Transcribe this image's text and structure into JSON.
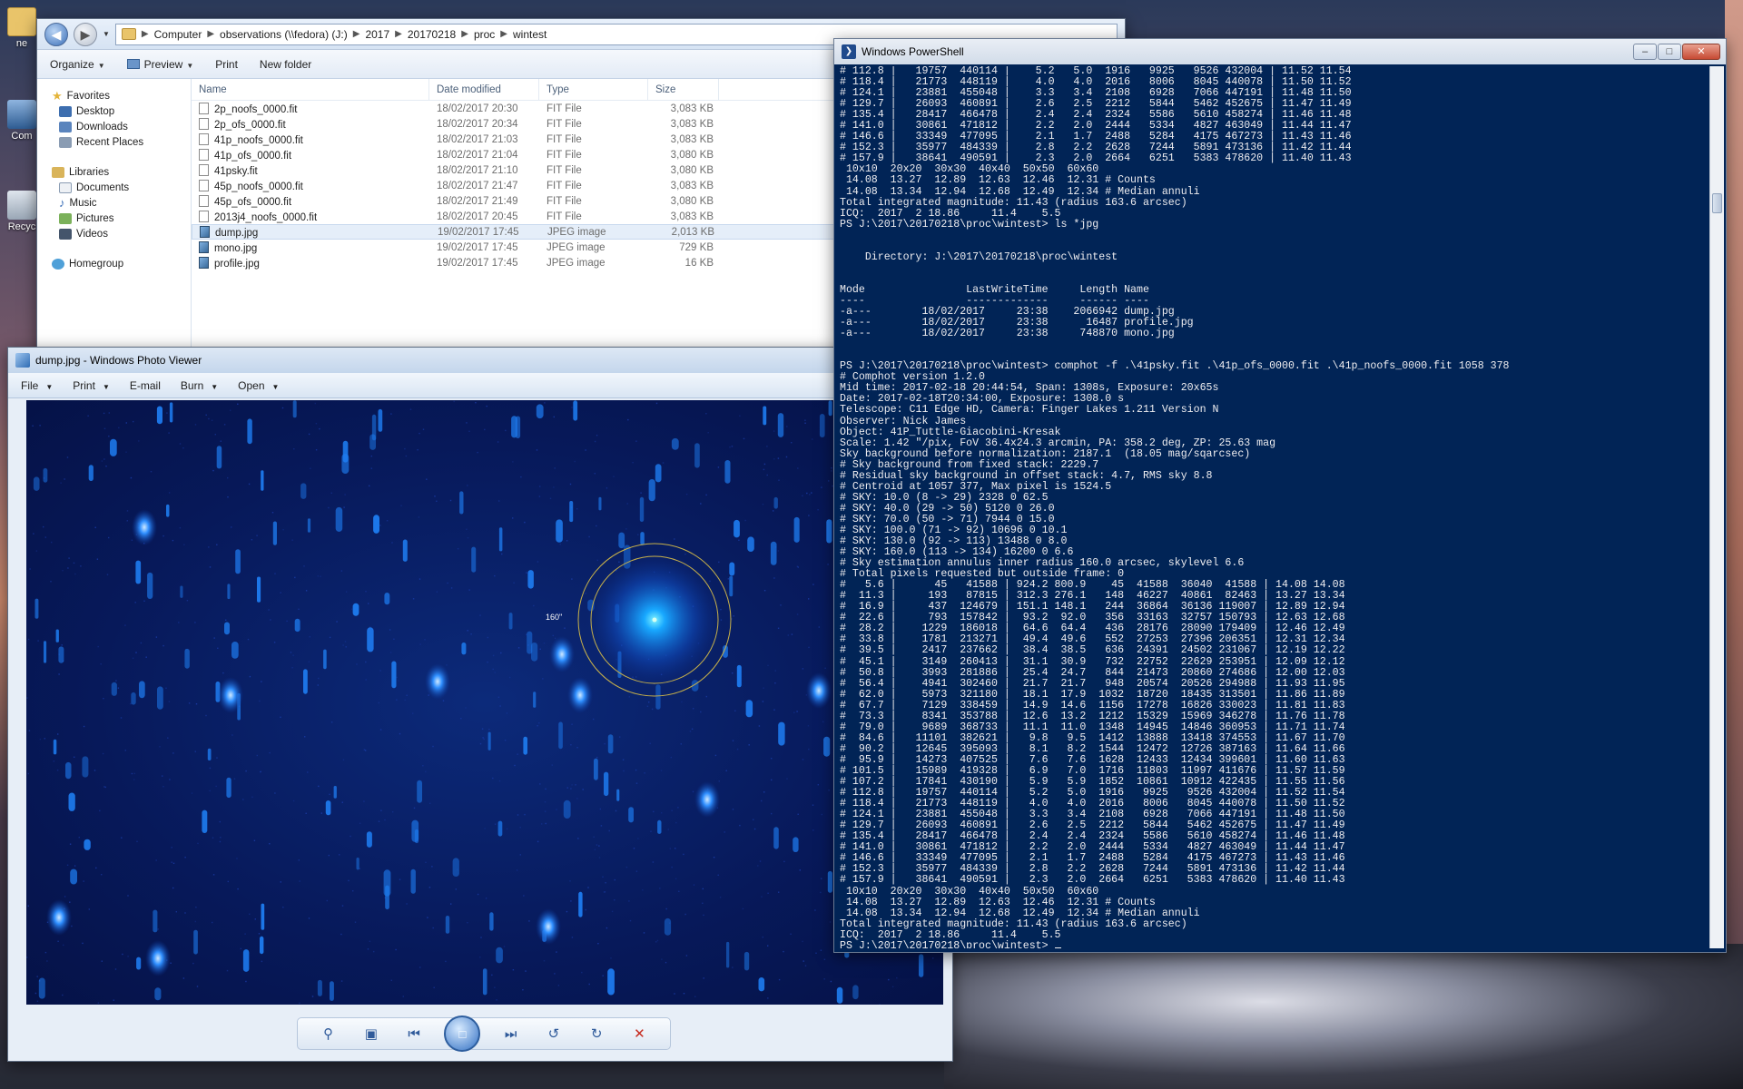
{
  "desktop": {
    "icons": [
      {
        "label": "ne"
      },
      {
        "label": "Com"
      },
      {
        "label": "Recyc"
      }
    ]
  },
  "explorer": {
    "breadcrumbs": [
      "Computer",
      "observations (\\\\fedora) (J:)",
      "2017",
      "20170218",
      "proc",
      "wintest"
    ],
    "toolbar": {
      "organize": "Organize",
      "preview": "Preview",
      "print": "Print",
      "new_folder": "New folder"
    },
    "nav": {
      "favorites": "Favorites",
      "desktop": "Desktop",
      "downloads": "Downloads",
      "recent": "Recent Places",
      "libraries": "Libraries",
      "documents": "Documents",
      "music": "Music",
      "pictures": "Pictures",
      "videos": "Videos",
      "homegroup": "Homegroup"
    },
    "columns": {
      "name": "Name",
      "date": "Date modified",
      "type": "Type",
      "size": "Size"
    },
    "files": [
      {
        "name": "2p_noofs_0000.fit",
        "date": "18/02/2017 20:30",
        "type": "FIT File",
        "size": "3,083 KB",
        "kind": "fit"
      },
      {
        "name": "2p_ofs_0000.fit",
        "date": "18/02/2017 20:34",
        "type": "FIT File",
        "size": "3,083 KB",
        "kind": "fit"
      },
      {
        "name": "41p_noofs_0000.fit",
        "date": "18/02/2017 21:03",
        "type": "FIT File",
        "size": "3,083 KB",
        "kind": "fit"
      },
      {
        "name": "41p_ofs_0000.fit",
        "date": "18/02/2017 21:04",
        "type": "FIT File",
        "size": "3,080 KB",
        "kind": "fit"
      },
      {
        "name": "41psky.fit",
        "date": "18/02/2017 21:10",
        "type": "FIT File",
        "size": "3,080 KB",
        "kind": "fit"
      },
      {
        "name": "45p_noofs_0000.fit",
        "date": "18/02/2017 21:47",
        "type": "FIT File",
        "size": "3,083 KB",
        "kind": "fit"
      },
      {
        "name": "45p_ofs_0000.fit",
        "date": "18/02/2017 21:49",
        "type": "FIT File",
        "size": "3,080 KB",
        "kind": "fit"
      },
      {
        "name": "2013j4_noofs_0000.fit",
        "date": "18/02/2017 20:45",
        "type": "FIT File",
        "size": "3,083 KB",
        "kind": "fit"
      },
      {
        "name": "dump.jpg",
        "date": "19/02/2017 17:45",
        "type": "JPEG image",
        "size": "2,013 KB",
        "kind": "jpg"
      },
      {
        "name": "mono.jpg",
        "date": "19/02/2017 17:45",
        "type": "JPEG image",
        "size": "729 KB",
        "kind": "jpg"
      },
      {
        "name": "profile.jpg",
        "date": "19/02/2017 17:45",
        "type": "JPEG image",
        "size": "16 KB",
        "kind": "jpg"
      }
    ],
    "selected_index": 8
  },
  "viewer": {
    "title": "dump.jpg - Windows Photo Viewer",
    "menu": {
      "file": "File",
      "print": "Print",
      "email": "E-mail",
      "burn": "Burn",
      "open": "Open"
    },
    "aperture_label": "160\""
  },
  "powershell": {
    "title": "Windows PowerShell",
    "lines": [
      "# 112.8 |   19757  440114 |    5.2   5.0  1916   9925   9526 432004 | 11.52 11.54",
      "# 118.4 |   21773  448119 |    4.0   4.0  2016   8006   8045 440078 | 11.50 11.52",
      "# 124.1 |   23881  455048 |    3.3   3.4  2108   6928   7066 447191 | 11.48 11.50",
      "# 129.7 |   26093  460891 |    2.6   2.5  2212   5844   5462 452675 | 11.47 11.49",
      "# 135.4 |   28417  466478 |    2.4   2.4  2324   5586   5610 458274 | 11.46 11.48",
      "# 141.0 |   30861  471812 |    2.2   2.0  2444   5334   4827 463049 | 11.44 11.47",
      "# 146.6 |   33349  477095 |    2.1   1.7  2488   5284   4175 467273 | 11.43 11.46",
      "# 152.3 |   35977  484339 |    2.8   2.2  2628   7244   5891 473136 | 11.42 11.44",
      "# 157.9 |   38641  490591 |    2.3   2.0  2664   6251   5383 478620 | 11.40 11.43",
      " 10x10  20x20  30x30  40x40  50x50  60x60",
      " 14.08  13.27  12.89  12.63  12.46  12.31 # Counts",
      " 14.08  13.34  12.94  12.68  12.49  12.34 # Median annuli",
      "Total integrated magnitude: 11.43 (radius 163.6 arcsec)",
      "ICQ:  2017  2 18.86     11.4    5.5",
      "PS J:\\2017\\20170218\\proc\\wintest> ls *jpg",
      "",
      "",
      "    Directory: J:\\2017\\20170218\\proc\\wintest",
      "",
      "",
      "Mode                LastWriteTime     Length Name",
      "----                -------------     ------ ----",
      "-a---        18/02/2017     23:38    2066942 dump.jpg",
      "-a---        18/02/2017     23:38      16487 profile.jpg",
      "-a---        18/02/2017     23:38     748870 mono.jpg",
      "",
      "",
      "PS J:\\2017\\20170218\\proc\\wintest> comphot -f .\\41psky.fit .\\41p_ofs_0000.fit .\\41p_noofs_0000.fit 1058 378",
      "# Comphot version 1.2.0",
      "Mid time: 2017-02-18 20:44:54, Span: 1308s, Exposure: 20x65s",
      "Date: 2017-02-18T20:34:00, Exposure: 1308.0 s",
      "Telescope: C11 Edge HD, Camera: Finger Lakes 1.211 Version N",
      "Observer: Nick James",
      "Object: 41P_Tuttle-Giacobini-Kresak",
      "Scale: 1.42 \"/pix, FoV 36.4x24.3 arcmin, PA: 358.2 deg, ZP: 25.63 mag",
      "Sky background before normalization: 2187.1  (18.05 mag/sqarcsec)",
      "# Sky background from fixed stack: 2229.7",
      "# Residual sky background in offset stack: 4.7, RMS sky 8.8",
      "# Centroid at 1057 377, Max pixel is 1524.5",
      "# SKY: 10.0 (8 -> 29) 2328 0 62.5",
      "# SKY: 40.0 (29 -> 50) 5120 0 26.0",
      "# SKY: 70.0 (50 -> 71) 7944 0 15.0",
      "# SKY: 100.0 (71 -> 92) 10696 0 10.1",
      "# SKY: 130.0 (92 -> 113) 13488 0 8.0",
      "# SKY: 160.0 (113 -> 134) 16200 0 6.6",
      "# Sky estimation annulus inner radius 160.0 arcsec, skylevel 6.6",
      "# Total pixels requested but outside frame: 0",
      "#   5.6 |      45   41588 | 924.2 800.9    45  41588  36040  41588 | 14.08 14.08",
      "#  11.3 |     193   87815 | 312.3 276.1   148  46227  40861  82463 | 13.27 13.34",
      "#  16.9 |     437  124679 | 151.1 148.1   244  36864  36136 119007 | 12.89 12.94",
      "#  22.6 |     793  157842 |  93.2  92.0   356  33163  32757 150793 | 12.63 12.68",
      "#  28.2 |    1229  186018 |  64.6  64.4   436  28176  28090 179409 | 12.46 12.49",
      "#  33.8 |    1781  213271 |  49.4  49.6   552  27253  27396 206351 | 12.31 12.34",
      "#  39.5 |    2417  237662 |  38.4  38.5   636  24391  24502 231067 | 12.19 12.22",
      "#  45.1 |    3149  260413 |  31.1  30.9   732  22752  22629 253951 | 12.09 12.12",
      "#  50.8 |    3993  281886 |  25.4  24.7   844  21473  20860 274686 | 12.00 12.03",
      "#  56.4 |    4941  302460 |  21.7  21.7   948  20574  20526 294988 | 11.93 11.95",
      "#  62.0 |    5973  321180 |  18.1  17.9  1032  18720  18435 313501 | 11.86 11.89",
      "#  67.7 |    7129  338459 |  14.9  14.6  1156  17278  16826 330023 | 11.81 11.83",
      "#  73.3 |    8341  353788 |  12.6  13.2  1212  15329  15969 346278 | 11.76 11.78",
      "#  79.0 |    9689  368733 |  11.1  11.0  1348  14945  14846 360953 | 11.71 11.74",
      "#  84.6 |   11101  382621 |   9.8   9.5  1412  13888  13418 374553 | 11.67 11.70",
      "#  90.2 |   12645  395093 |   8.1   8.2  1544  12472  12726 387163 | 11.64 11.66",
      "#  95.9 |   14273  407525 |   7.6   7.6  1628  12433  12434 399601 | 11.60 11.63",
      "# 101.5 |   15989  419328 |   6.9   7.0  1716  11803  11997 411676 | 11.57 11.59",
      "# 107.2 |   17841  430190 |   5.9   5.9  1852  10861  10912 422435 | 11.55 11.56",
      "# 112.8 |   19757  440114 |   5.2   5.0  1916   9925   9526 432004 | 11.52 11.54",
      "# 118.4 |   21773  448119 |   4.0   4.0  2016   8006   8045 440078 | 11.50 11.52",
      "# 124.1 |   23881  455048 |   3.3   3.4  2108   6928   7066 447191 | 11.48 11.50",
      "# 129.7 |   26093  460891 |   2.6   2.5  2212   5844   5462 452675 | 11.47 11.49",
      "# 135.4 |   28417  466478 |   2.4   2.4  2324   5586   5610 458274 | 11.46 11.48",
      "# 141.0 |   30861  471812 |   2.2   2.0  2444   5334   4827 463049 | 11.44 11.47",
      "# 146.6 |   33349  477095 |   2.1   1.7  2488   5284   4175 467273 | 11.43 11.46",
      "# 152.3 |   35977  484339 |   2.8   2.2  2628   7244   5891 473136 | 11.42 11.44",
      "# 157.9 |   38641  490591 |   2.3   2.0  2664   6251   5383 478620 | 11.40 11.43",
      " 10x10  20x20  30x30  40x40  50x50  60x60",
      " 14.08  13.27  12.89  12.63  12.46  12.31 # Counts",
      " 14.08  13.34  12.94  12.68  12.49  12.34 # Median annuli",
      "Total integrated magnitude: 11.43 (radius 163.6 arcsec)",
      "ICQ:  2017  2 18.86     11.4    5.5"
    ],
    "prompt": "PS J:\\2017\\20170218\\proc\\wintest> "
  },
  "colors": {
    "ps_background": "#012456",
    "ps_text": "#eeedf0",
    "image_background": "#07195a",
    "star": "#2f8fff",
    "aperture": "#c8b14a"
  }
}
